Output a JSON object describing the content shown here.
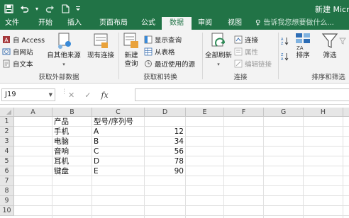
{
  "titlebar": {
    "title": "新建 Microsoft Excel 工作表.xlsx - Excel",
    "save_icon": "save-icon",
    "undo_icon": "undo-icon",
    "redo_icon": "redo-icon",
    "new_icon": "new-document-icon",
    "customize_icon": "chevron-down-icon"
  },
  "tabs": [
    "文件",
    "开始",
    "插入",
    "页面布局",
    "公式",
    "数据",
    "审阅",
    "视图"
  ],
  "active_tab": "数据",
  "tellme": "告诉我您想要做什么...",
  "ribbon": {
    "get_external": {
      "access": "自 Access",
      "web": "自网站",
      "text": "自文本",
      "other": "自其他来源",
      "existing": "现有连接",
      "label": "获取外部数据"
    },
    "get_transform": {
      "new_query_line1": "新建",
      "new_query_line2": "查询",
      "show_queries": "显示查询",
      "from_table": "从表格",
      "recent_sources": "最近使用的源",
      "label": "获取和转换"
    },
    "connections": {
      "refresh_all": "全部刷新",
      "connections": "连接",
      "properties": "属性",
      "edit_links": "编辑链接",
      "label": "连接"
    },
    "sort_filter": {
      "sort": "排序",
      "filter": "筛选",
      "label": "排序和筛选"
    }
  },
  "formula_bar": {
    "name_box": "J19",
    "cancel_icon": "✕",
    "enter_icon": "✓",
    "fx_label": "fx",
    "formula": ""
  },
  "columns": [
    "A",
    "B",
    "C",
    "D",
    "E",
    "F",
    "G",
    "H"
  ],
  "rows": [
    "1",
    "2",
    "3",
    "4",
    "5",
    "6",
    "7",
    "8",
    "9",
    "10"
  ],
  "cells": {
    "B1": "产品",
    "C1": "型号/序列号",
    "B2": "手机",
    "C2": "A",
    "D2": "12",
    "B3": "电脑",
    "C3": "B",
    "D3": "34",
    "B4": "音响",
    "C4": "C",
    "D4": "56",
    "B5": "耳机",
    "C5": "D",
    "D5": "78",
    "B6": "键盘",
    "C6": "E",
    "D6": "90"
  },
  "colors": {
    "excel_green": "#217346",
    "ribbon_bg": "#f3f3f3",
    "header_bg": "#e6e6e6"
  }
}
